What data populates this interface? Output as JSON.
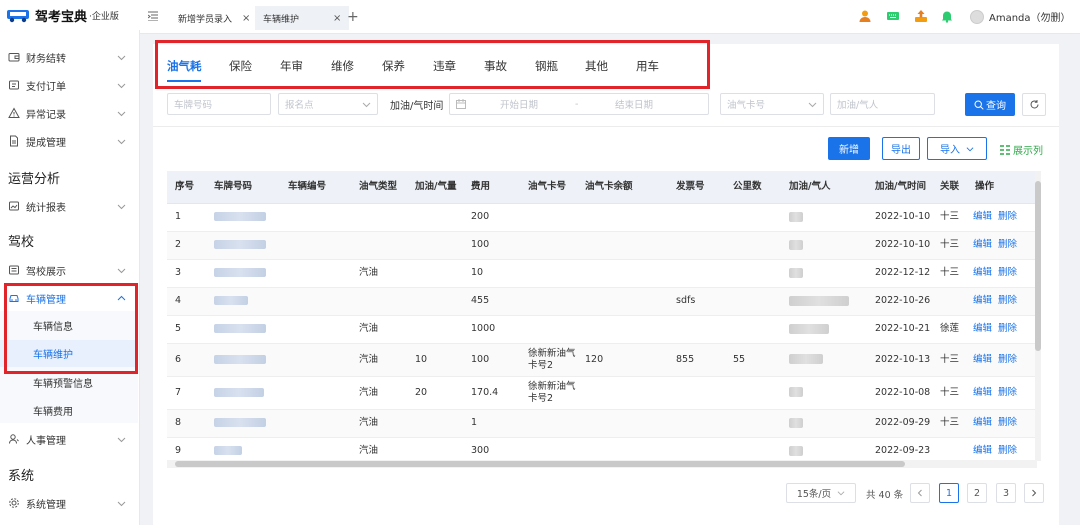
{
  "app": {
    "logo_name": "驾考宝典",
    "logo_edition": "·企业版"
  },
  "sidebar": {
    "items": [
      {
        "label": "财务结转"
      },
      {
        "label": "支付订单"
      },
      {
        "label": "异常记录"
      },
      {
        "label": "提成管理"
      }
    ],
    "group_ops": "运营分析",
    "stats": "统计报表",
    "group_school": "驾校",
    "school_display": "驾校展示",
    "vehicle_mgmt": "车辆管理",
    "vehicle_sub": [
      "车辆信息",
      "车辆维护",
      "车辆预警信息",
      "车辆费用"
    ],
    "hr": "人事管理",
    "group_sys": "系统",
    "sys_mgmt": "系统管理"
  },
  "header": {
    "tabs": [
      {
        "label": "新增学员录入"
      },
      {
        "label": "车辆维护"
      }
    ],
    "user": "Amanda（勿删）"
  },
  "content_tabs": [
    "油气耗",
    "保险",
    "年审",
    "维修",
    "保养",
    "违章",
    "事故",
    "钢瓶",
    "其他",
    "用车"
  ],
  "filters": {
    "plate_placeholder": "车牌号码",
    "site_placeholder": "报名点",
    "time_label": "加油/气时间",
    "start_placeholder": "开始日期",
    "range_sep": "-",
    "end_placeholder": "结束日期",
    "card_placeholder": "油气卡号",
    "person_placeholder": "加油/气人",
    "query": "查询"
  },
  "actions": {
    "add": "新增",
    "export": "导出",
    "import": "导入",
    "columns": "展示列"
  },
  "table": {
    "headers": [
      "序号",
      "车牌号码",
      "车辆编号",
      "油气类型",
      "加油/气量",
      "费用",
      "油气卡号",
      "油气卡余额",
      "发票号",
      "公里数",
      "加油/气人",
      "加油/气时间",
      "关联",
      "操作"
    ],
    "rows": [
      {
        "no": "1",
        "type": "",
        "qty": "",
        "fee": "200",
        "card": "",
        "bal": "",
        "inv": "",
        "km": "",
        "time": "2022-10-10",
        "rel": "十三"
      },
      {
        "no": "2",
        "type": "",
        "qty": "",
        "fee": "100",
        "card": "",
        "bal": "",
        "inv": "",
        "km": "",
        "time": "2022-10-10",
        "rel": "十三"
      },
      {
        "no": "3",
        "type": "汽油",
        "qty": "",
        "fee": "10",
        "card": "",
        "bal": "",
        "inv": "",
        "km": "",
        "time": "2022-12-12",
        "rel": "十三"
      },
      {
        "no": "4",
        "type": "",
        "qty": "",
        "fee": "455",
        "card": "",
        "bal": "",
        "inv": "sdfs",
        "km": "",
        "time": "2022-10-26",
        "rel": ""
      },
      {
        "no": "5",
        "type": "汽油",
        "qty": "",
        "fee": "1000",
        "card": "",
        "bal": "",
        "inv": "",
        "km": "",
        "time": "2022-10-21",
        "rel": "徐莲"
      },
      {
        "no": "6",
        "type": "汽油",
        "qty": "10",
        "fee": "100",
        "card": "徐新新油气卡号2",
        "bal": "120",
        "inv": "855",
        "km": "55",
        "time": "2022-10-13",
        "rel": "十三"
      },
      {
        "no": "7",
        "type": "汽油",
        "qty": "20",
        "fee": "170.4",
        "card": "徐新新油气卡号2",
        "bal": "",
        "inv": "",
        "km": "",
        "time": "2022-10-08",
        "rel": "十三"
      },
      {
        "no": "8",
        "type": "汽油",
        "qty": "",
        "fee": "1",
        "card": "",
        "bal": "",
        "inv": "",
        "km": "",
        "time": "2022-09-29",
        "rel": "十三"
      },
      {
        "no": "9",
        "type": "汽油",
        "qty": "",
        "fee": "300",
        "card": "",
        "bal": "",
        "inv": "",
        "km": "",
        "time": "2022-09-23",
        "rel": ""
      }
    ],
    "op_edit": "编辑",
    "op_delete": "删除"
  },
  "pagination": {
    "page_size": "15条/页",
    "total": "共 40 条",
    "pages": [
      "1",
      "2",
      "3"
    ]
  }
}
